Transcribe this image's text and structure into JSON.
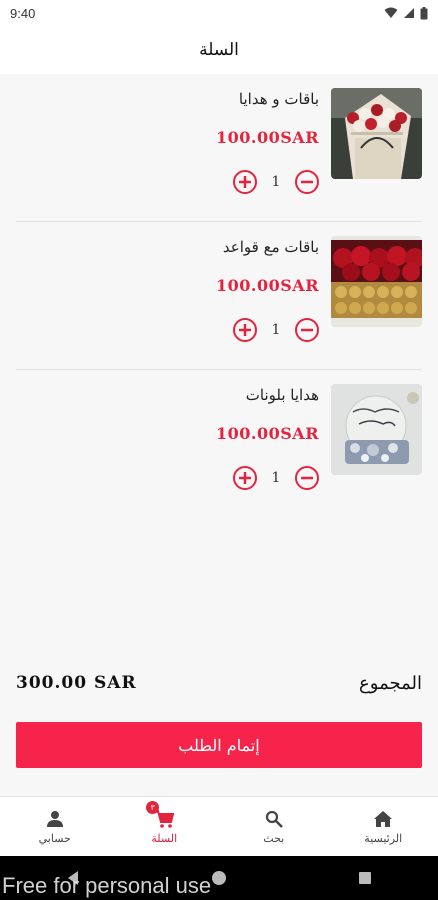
{
  "status_bar": {
    "time": "9:40"
  },
  "app_bar": {
    "title": "السلة"
  },
  "cart": {
    "items": [
      {
        "title": "باقات و هدايا",
        "price": "100.00SAR",
        "quantity": "1",
        "image": "white-red-rose-bouquet-in-bag"
      },
      {
        "title": "باقات مع قواعد",
        "price": "100.00SAR",
        "quantity": "1",
        "image": "red-roses-with-chocolates-box"
      },
      {
        "title": "هدايا بلونات",
        "price": "100.00SAR",
        "quantity": "1",
        "image": "happy-birthday-balloon-gift"
      }
    ]
  },
  "summary": {
    "total_label": "المجموع",
    "total_amount": "300.00 SAR"
  },
  "checkout": {
    "label": "إتمام الطلب"
  },
  "bottom_nav": {
    "items": [
      {
        "label": "حسابي",
        "icon": "person-icon"
      },
      {
        "label": "السلة",
        "icon": "cart-icon",
        "badge": "٣"
      },
      {
        "label": "بحث",
        "icon": "search-icon"
      },
      {
        "label": "الرئيسية",
        "icon": "home-icon"
      }
    ]
  },
  "watermark": "Free for personal use",
  "colors": {
    "accent": "#e4233f",
    "button": "#f6244a",
    "background": "#f7f7f7"
  }
}
